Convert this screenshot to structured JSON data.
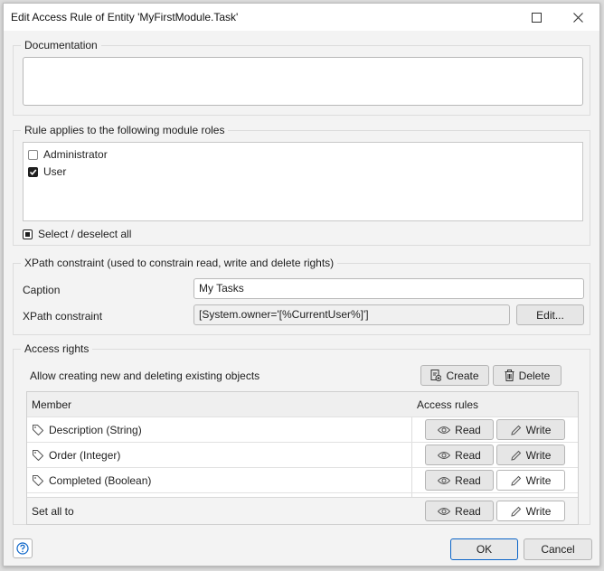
{
  "window": {
    "title": "Edit Access Rule of Entity 'MyFirstModule.Task'"
  },
  "documentation": {
    "legend": "Documentation",
    "value": ""
  },
  "roles": {
    "legend": "Rule applies to the following module roles",
    "items": [
      {
        "label": "Administrator",
        "checked": false
      },
      {
        "label": "User",
        "checked": true
      }
    ],
    "select_all_label": "Select / deselect all"
  },
  "xpath": {
    "legend": "XPath constraint (used to constrain read, write and delete rights)",
    "caption_label": "Caption",
    "caption_value": "My Tasks",
    "constraint_label": "XPath constraint",
    "constraint_value": "[System.owner='[%CurrentUser%]']",
    "edit_label": "Edit..."
  },
  "access": {
    "legend": "Access rights",
    "allow_text": "Allow creating new and deleting existing objects",
    "create_label": "Create",
    "delete_label": "Delete",
    "col_member": "Member",
    "col_rules": "Access rules",
    "members": [
      {
        "label": "Description (String)",
        "read": "Read",
        "write": "Write",
        "write_selected": true
      },
      {
        "label": "Order (Integer)",
        "read": "Read",
        "write": "Write",
        "write_selected": true
      },
      {
        "label": "Completed (Boolean)",
        "read": "Read",
        "write": "Write",
        "write_selected": false
      }
    ],
    "set_all_label": "Set all to",
    "set_all_read": "Read",
    "set_all_write": "Write"
  },
  "footer": {
    "help_icon": "question-circle-icon",
    "ok_label": "OK",
    "cancel_label": "Cancel"
  },
  "colors": {
    "accent": "#0a64c8",
    "window_bg": "#f3f3f3"
  }
}
